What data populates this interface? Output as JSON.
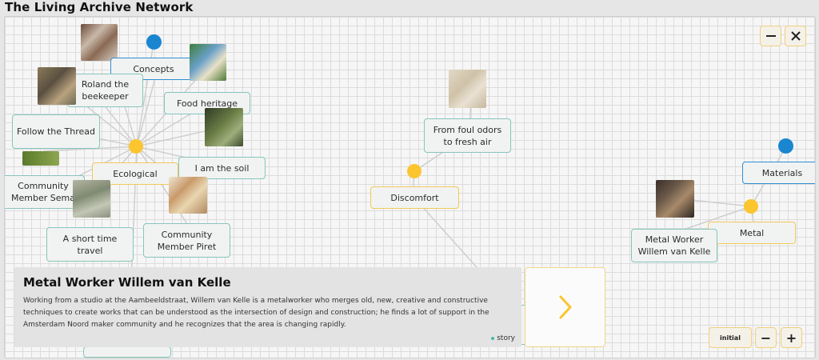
{
  "app": {
    "title": "The Living Archive Network"
  },
  "window_controls": {
    "minimize_icon": "minus-icon",
    "close_icon": "close-icon"
  },
  "nodes": {
    "concepts": "Concepts",
    "roland": "Roland the beekeeper",
    "food_heritage": "Food heritage",
    "follow_thread": "Follow the Thread",
    "ecological": "Ecological",
    "soil": "I am the soil",
    "community_sema": "Community Member Sema",
    "short_time": "A short time travel",
    "community_piret": "Community Member Piret",
    "foul_odors": "From foul odors to fresh air",
    "discomfort": "Discomfort",
    "materials": "Materials",
    "metal": "Metal",
    "metal_worker": "Metal Worker Willem van Kelle"
  },
  "info": {
    "title": "Metal Worker Willem van Kelle",
    "description": "Working from a studio at the Aambeeldstraat, Willem van Kelle is a metalworker who merges old, new, creative and constructive techniques to create works that can be understood as the intersection of design and construction; he finds a lot of support in the Amsterdam Noord maker community and he recognizes that the area is changing rapidly.",
    "tag": "story"
  },
  "zoom_controls": {
    "reset_label": "initial",
    "zoom_out": "−",
    "zoom_in": "+"
  },
  "colors": {
    "concept_dot": "#1a86d0",
    "category_dot": "#fbc52f",
    "story_border": "#86c5bd",
    "category_border": "#f1c95a"
  }
}
